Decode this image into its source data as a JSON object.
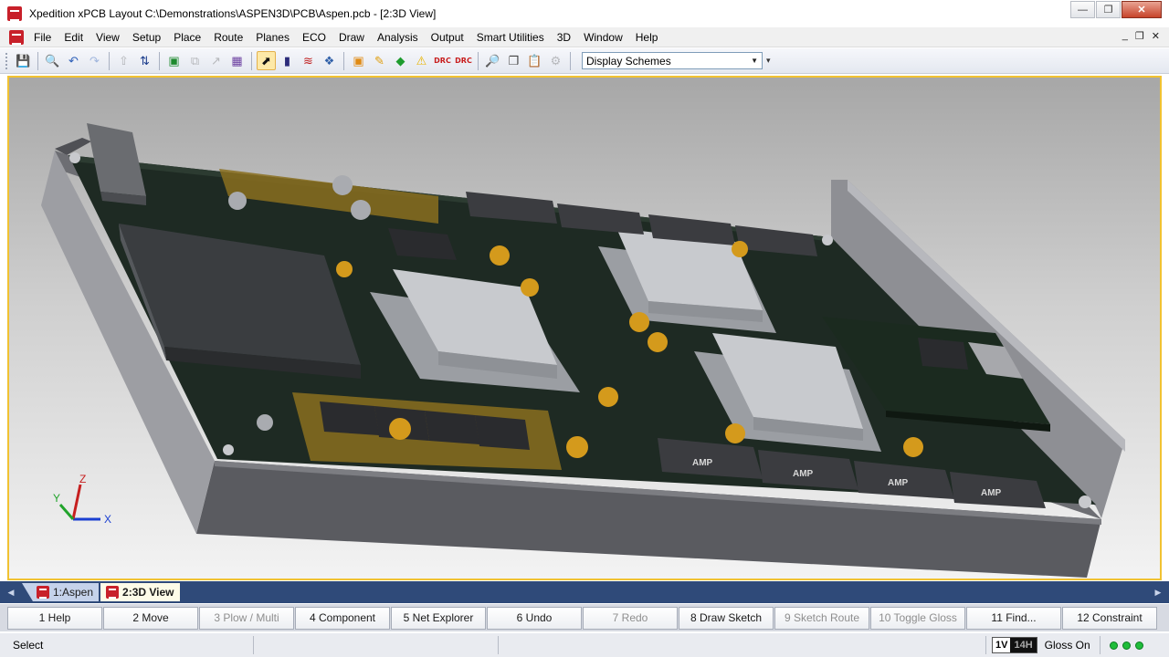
{
  "window": {
    "title": "Xpedition xPCB Layout  C:\\Demonstrations\\ASPEN3D\\PCB\\Aspen.pcb - [2:3D View]",
    "minimize": "—",
    "restore": "❐",
    "close": "✕"
  },
  "menu": {
    "items": [
      "File",
      "Edit",
      "View",
      "Setup",
      "Place",
      "Route",
      "Planes",
      "ECO",
      "Draw",
      "Analysis",
      "Output",
      "Smart Utilities",
      "3D",
      "Window",
      "Help"
    ],
    "mdi": [
      "_",
      "❐",
      "✕"
    ]
  },
  "toolbar": {
    "drc_label": "DRC",
    "drc2_label": "DRC",
    "scheme_value": "Display Schemes"
  },
  "viewport": {
    "axis_x": "X",
    "axis_y": "Y",
    "axis_z": "Z",
    "amp_label": "AMP"
  },
  "tabs": [
    {
      "label": "1:Aspen",
      "active": false
    },
    {
      "label": "2:3D View",
      "active": true
    }
  ],
  "fkeys": [
    {
      "label": "1 Help",
      "enabled": true
    },
    {
      "label": "2 Move",
      "enabled": true
    },
    {
      "label": "3 Plow / Multi",
      "enabled": false
    },
    {
      "label": "4 Component",
      "enabled": true
    },
    {
      "label": "5 Net Explorer",
      "enabled": true
    },
    {
      "label": "6 Undo",
      "enabled": true
    },
    {
      "label": "7 Redo",
      "enabled": false
    },
    {
      "label": "8 Draw Sketch",
      "enabled": true
    },
    {
      "label": "9 Sketch Route",
      "enabled": false
    },
    {
      "label": "10 Toggle Gloss",
      "enabled": false
    },
    {
      "label": "11 Find...",
      "enabled": true
    },
    {
      "label": "12 Constraint",
      "enabled": true
    }
  ],
  "status": {
    "mode": "Select",
    "layer_v": "1V",
    "layer_h": "14H",
    "gloss": "Gloss On"
  }
}
